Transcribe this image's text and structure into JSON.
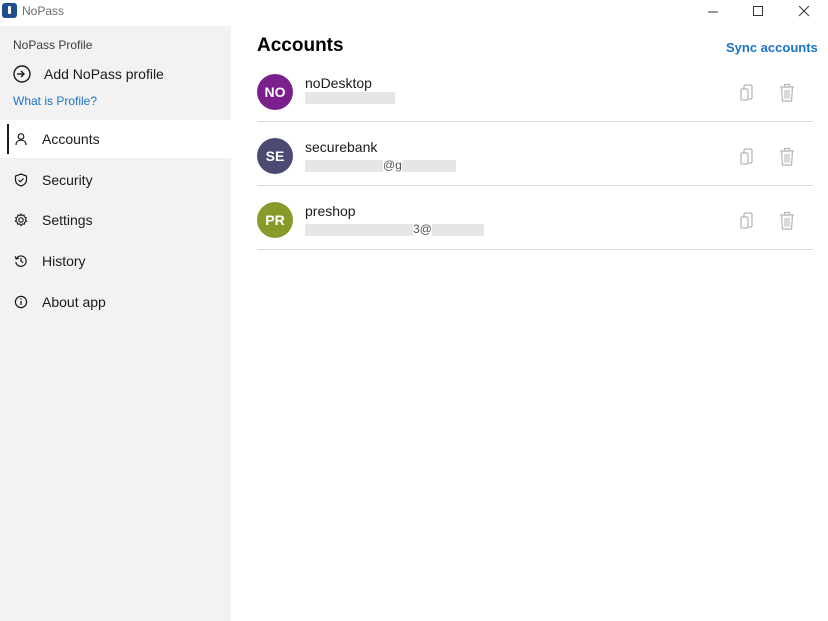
{
  "window": {
    "title": "NoPass"
  },
  "sidebar": {
    "profile_heading": "NoPass Profile",
    "add_profile_label": "Add NoPass profile",
    "what_is_profile_link": "What is Profile?",
    "items": [
      {
        "label": "Accounts",
        "icon": "person-icon",
        "active": true
      },
      {
        "label": "Security",
        "icon": "shield-icon",
        "active": false
      },
      {
        "label": "Settings",
        "icon": "gear-icon",
        "active": false
      },
      {
        "label": "History",
        "icon": "history-icon",
        "active": false
      },
      {
        "label": "About app",
        "icon": "info-icon",
        "active": false
      }
    ]
  },
  "main": {
    "title": "Accounts",
    "sync_label": "Sync accounts",
    "accounts": [
      {
        "initials": "NO",
        "name": "noDesktop",
        "email_visible": "",
        "avatar_color": "#7b1f8c"
      },
      {
        "initials": "SE",
        "name": "securebank",
        "email_visible": "@g",
        "avatar_color": "#4a4a72"
      },
      {
        "initials": "PR",
        "name": "preshop",
        "email_visible": "3@",
        "avatar_color": "#8a9a2a"
      }
    ]
  },
  "colors": {
    "accent": "#1a73c7",
    "sidebar_bg": "#f2f2f2",
    "divider": "#dcdcdc",
    "icon_gray": "#b5b5b5"
  }
}
